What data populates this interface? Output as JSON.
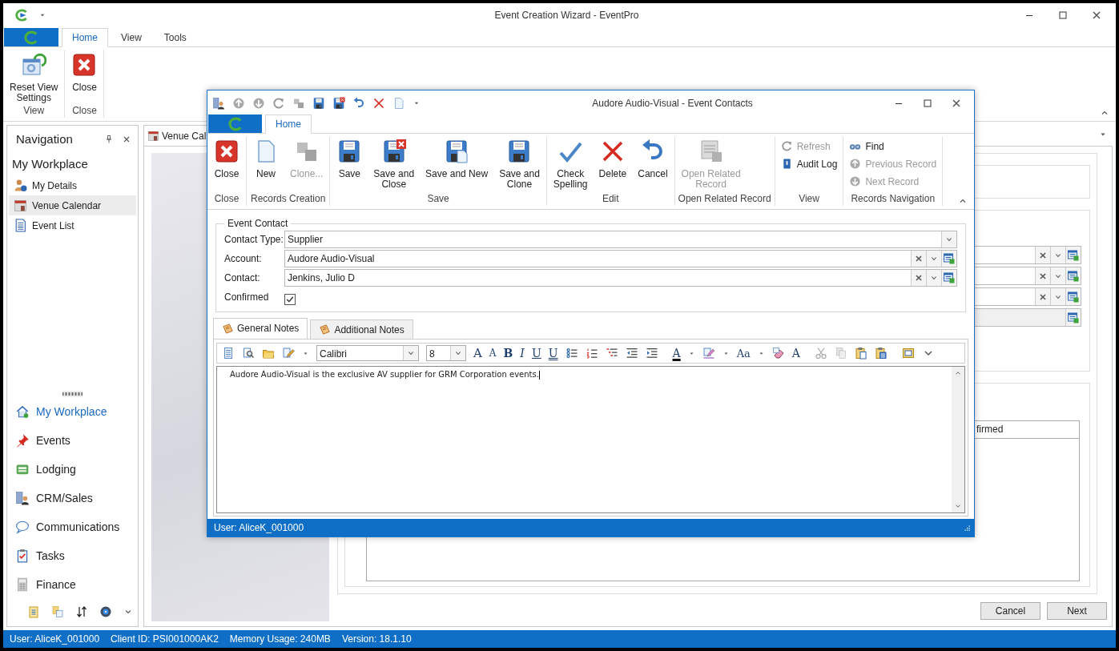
{
  "window": {
    "title": "Event Creation Wizard - EventPro"
  },
  "ribbon": {
    "tabs": [
      {
        "label": "Home",
        "selected": true
      },
      {
        "label": "View",
        "selected": false
      },
      {
        "label": "Tools",
        "selected": false
      }
    ],
    "groups": [
      {
        "label": "View",
        "buttons": [
          {
            "label": "Reset View\nSettings",
            "kind": "reset"
          }
        ]
      },
      {
        "label": "Close",
        "buttons": [
          {
            "label": "Close",
            "kind": "close"
          }
        ]
      }
    ]
  },
  "navigation": {
    "title": "Navigation",
    "heading": "My Workplace",
    "items": [
      {
        "label": "My Details",
        "kind": "person",
        "selected": false
      },
      {
        "label": "Venue Calendar",
        "kind": "calendar",
        "selected": true
      },
      {
        "label": "Event List",
        "kind": "list",
        "selected": false
      }
    ],
    "modules": [
      {
        "label": "My Workplace",
        "kind": "home",
        "selected": true
      },
      {
        "label": "Events",
        "kind": "pin",
        "selected": false
      },
      {
        "label": "Lodging",
        "kind": "bed",
        "selected": false
      },
      {
        "label": "CRM/Sales",
        "kind": "crm",
        "selected": false
      },
      {
        "label": "Communications",
        "kind": "bubble",
        "selected": false
      },
      {
        "label": "Tasks",
        "kind": "tasks",
        "selected": false
      },
      {
        "label": "Finance",
        "kind": "calc",
        "selected": false
      }
    ]
  },
  "document_tab": {
    "label": "Venue Cal"
  },
  "wizard": {
    "fields": [
      {
        "kind": "lookup"
      },
      {
        "kind": "lookup"
      },
      {
        "kind": "lookup"
      },
      {
        "kind": "readonly"
      }
    ],
    "grid_header": "firmed",
    "buttons": [
      "Cancel",
      "Next"
    ]
  },
  "dialog": {
    "title": "Audore Audio-Visual - Event Contacts",
    "tabs": [
      {
        "label": "Home",
        "selected": true
      }
    ],
    "groups": [
      {
        "label": "Close",
        "kind": "large",
        "buttons": [
          {
            "label": "Close",
            "kind": "close",
            "disabled": false
          }
        ]
      },
      {
        "label": "Records Creation",
        "kind": "large",
        "buttons": [
          {
            "label": "New",
            "kind": "new",
            "disabled": false
          },
          {
            "label": "Clone...",
            "kind": "clone",
            "disabled": true
          }
        ]
      },
      {
        "label": "Save",
        "kind": "large",
        "buttons": [
          {
            "label": "Save",
            "kind": "save",
            "disabled": false
          },
          {
            "label": "Save and\nClose",
            "kind": "save-close",
            "disabled": false
          },
          {
            "label": "Save and New",
            "kind": "save-new",
            "disabled": false
          },
          {
            "label": "Save and\nClone",
            "kind": "save-clone",
            "disabled": false
          }
        ]
      },
      {
        "label": "Edit",
        "kind": "large",
        "buttons": [
          {
            "label": "Check\nSpelling",
            "kind": "spell",
            "disabled": false
          },
          {
            "label": "Delete",
            "kind": "delete",
            "disabled": false
          },
          {
            "label": "Cancel",
            "kind": "undo",
            "disabled": false
          }
        ]
      },
      {
        "label": "Open Related Record",
        "kind": "large",
        "buttons": [
          {
            "label": "Open Related\nRecord",
            "kind": "related",
            "disabled": true
          }
        ]
      },
      {
        "label": "View",
        "kind": "small",
        "buttons": [
          {
            "label": "Refresh",
            "kind": "refresh",
            "disabled": true
          },
          {
            "label": "Audit Log",
            "kind": "audit",
            "disabled": false
          }
        ]
      },
      {
        "label": "Records Navigation",
        "kind": "small",
        "buttons": [
          {
            "label": "Find",
            "kind": "find",
            "disabled": false
          },
          {
            "label": "Previous Record",
            "kind": "up",
            "disabled": true
          },
          {
            "label": "Next Record",
            "kind": "down",
            "disabled": true
          }
        ]
      }
    ],
    "form": {
      "title": "Event Contact",
      "rows": [
        {
          "label": "Contact Type:",
          "kind": "combo",
          "value": "Supplier"
        },
        {
          "label": "Account:",
          "kind": "lookup",
          "value": "Audore Audio-Visual"
        },
        {
          "label": "Contact:",
          "kind": "lookup",
          "value": "Jenkins, Julio D"
        },
        {
          "label": "Confirmed",
          "kind": "check",
          "checked": true
        }
      ]
    },
    "note_tabs": [
      {
        "label": "General Notes",
        "selected": true
      },
      {
        "label": "Additional Notes",
        "selected": false
      }
    ],
    "editor": {
      "toolbar": [
        {
          "kind": "docview"
        },
        {
          "kind": "findtext"
        },
        {
          "kind": "folder"
        },
        {
          "kind": "pen"
        },
        {
          "kind": "font",
          "value": "Calibri"
        },
        {
          "kind": "size",
          "value": "8"
        },
        {
          "kind": "grow",
          "text": "A"
        },
        {
          "kind": "shrink",
          "text": "A"
        },
        {
          "kind": "bold",
          "text": "B"
        },
        {
          "kind": "italic",
          "text": "I"
        },
        {
          "kind": "underline",
          "text": "U"
        },
        {
          "kind": "double-underline",
          "text": "U"
        },
        {
          "kind": "bullets"
        },
        {
          "kind": "numbering"
        },
        {
          "kind": "multilevel"
        },
        {
          "kind": "outdent"
        },
        {
          "kind": "indent"
        },
        {
          "kind": "separator"
        },
        {
          "kind": "font-color",
          "text": "A"
        },
        {
          "kind": "highlight"
        },
        {
          "kind": "case",
          "text": "Aa"
        },
        {
          "kind": "clear-format"
        },
        {
          "kind": "style",
          "text": "A"
        },
        {
          "kind": "separator"
        },
        {
          "kind": "cut"
        },
        {
          "kind": "copy"
        },
        {
          "kind": "paste"
        },
        {
          "kind": "paste-special"
        },
        {
          "kind": "separator"
        },
        {
          "kind": "field"
        },
        {
          "kind": "more"
        }
      ],
      "text": "Audore Audio-Visual is the exclusive AV supplier for GRM Corporation events."
    },
    "status": "User: AliceK_001000"
  },
  "status_bar": [
    "User: AliceK_001000",
    "Client ID: PSI001000AK2",
    "Memory Usage: 240MB",
    "Version: 18.1.10"
  ]
}
